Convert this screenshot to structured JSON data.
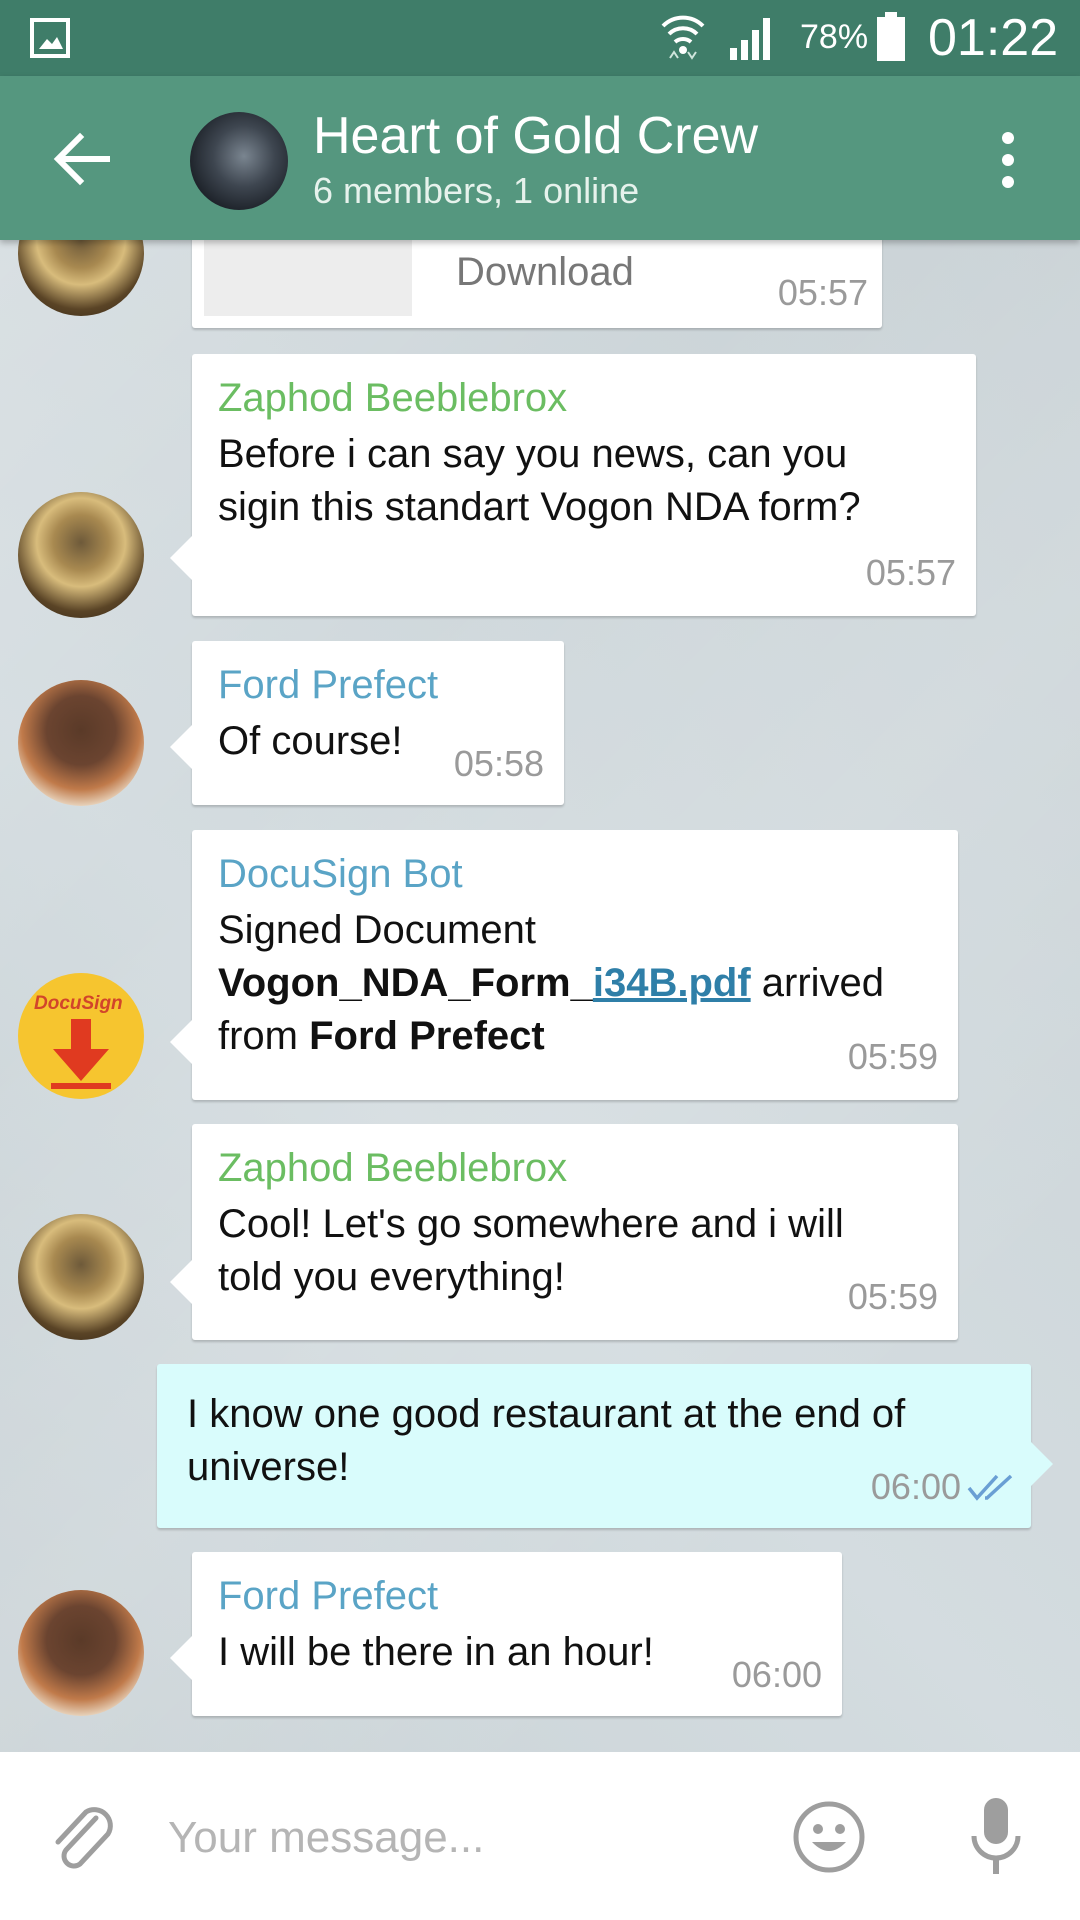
{
  "status_bar": {
    "battery_percent": "78%",
    "clock": "01:22"
  },
  "header": {
    "title": "Heart of Gold Crew",
    "subtitle": "6 members, 1 online"
  },
  "messages": [
    {
      "download_label": "Download",
      "time": "05:57"
    },
    {
      "sender": "Zaphod Beeblebrox",
      "lines": [
        "Before i can say you news, can you",
        "sigin this standart Vogon NDA form?"
      ],
      "time": "05:57"
    },
    {
      "sender": "Ford Prefect",
      "text": "Of course!",
      "time": "05:58"
    },
    {
      "sender": "DocuSign Bot",
      "line1": "Signed Document",
      "file_part_bold": "Vogon_NDA_Form_",
      "file_part_link": "i34B.pdf",
      "after_file": " arrived",
      "from_prefix": "from ",
      "from_name": "Ford Prefect",
      "time": "05:59"
    },
    {
      "sender": "Zaphod Beeblebrox",
      "lines": [
        "Cool! Let's go somewhere and i will",
        "told you everything!"
      ],
      "time": "05:59"
    },
    {
      "lines": [
        "I know one good restaurant at the end of",
        "universe!"
      ],
      "time": "06:00",
      "status": "read"
    },
    {
      "sender": "Ford Prefect",
      "text": "I will be there in an hour!",
      "time": "06:00"
    }
  ],
  "docusign_logo_text": "DocuSign",
  "input": {
    "placeholder": "Your message..."
  },
  "colors": {
    "status_bar": "#3f7d69",
    "app_bar": "#55977f",
    "outgoing_bubble": "#d9fcfc",
    "green_sender": "#6bbd62",
    "blue_sender": "#5aa4c6",
    "docusign_yellow": "#f6c52f",
    "docusign_red": "#e03a20"
  },
  "icons": [
    "image-icon",
    "wifi-icon",
    "signal-icon",
    "battery-icon",
    "back-arrow-icon",
    "more-vert-icon",
    "paperclip-icon",
    "emoji-icon",
    "mic-icon",
    "double-check-icon",
    "download-arrow-icon"
  ]
}
